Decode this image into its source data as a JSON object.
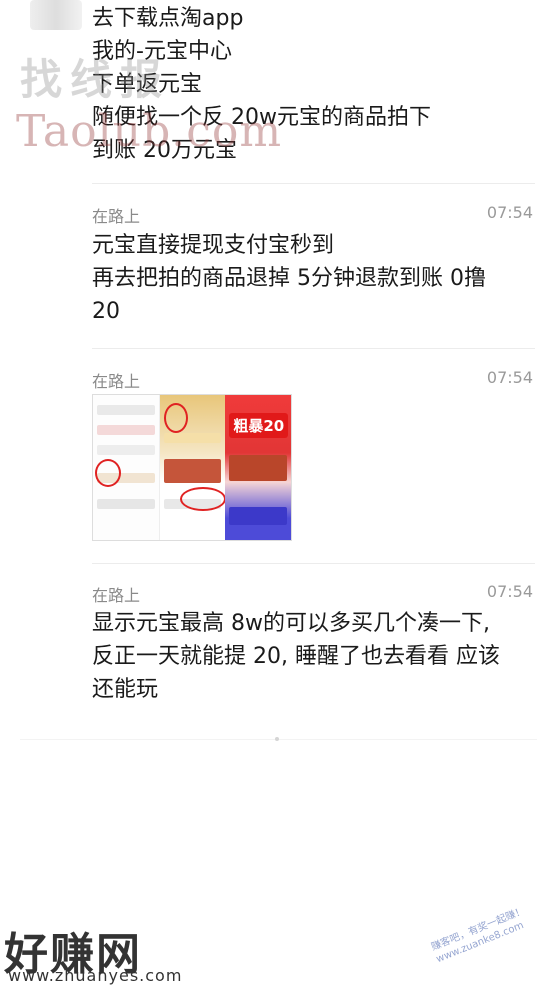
{
  "intro": {
    "lines": [
      "去下载点淘app",
      "我的-元宝中心",
      "下单返元宝",
      "随便找一个反 20w元宝的商品拍下",
      "到账 20万元宝"
    ]
  },
  "watermarks": {
    "cn": "找线报",
    "en": "Taolub.com"
  },
  "messages": [
    {
      "sender": "在路上",
      "time": "07:54",
      "lines": [
        "元宝直接提现支付宝秒到",
        "再去把拍的商品退掉 5分钟退款到账  0撸",
        "20"
      ]
    },
    {
      "sender": "在路上",
      "time": "07:54",
      "image": {
        "badge": "粗暴20"
      }
    },
    {
      "sender": "在路上",
      "time": "07:54",
      "lines": [
        "显示元宝最高 8w的可以多买几个凑一下,",
        "反正一天就能提 20, 睡醒了也去看看 应该",
        "还能玩"
      ]
    }
  ],
  "branding": {
    "logo": "好赚网",
    "url": "www.zhuanyes.com",
    "stamp": "赚客吧，有奖一起赚！ www.zuanke8.com"
  }
}
